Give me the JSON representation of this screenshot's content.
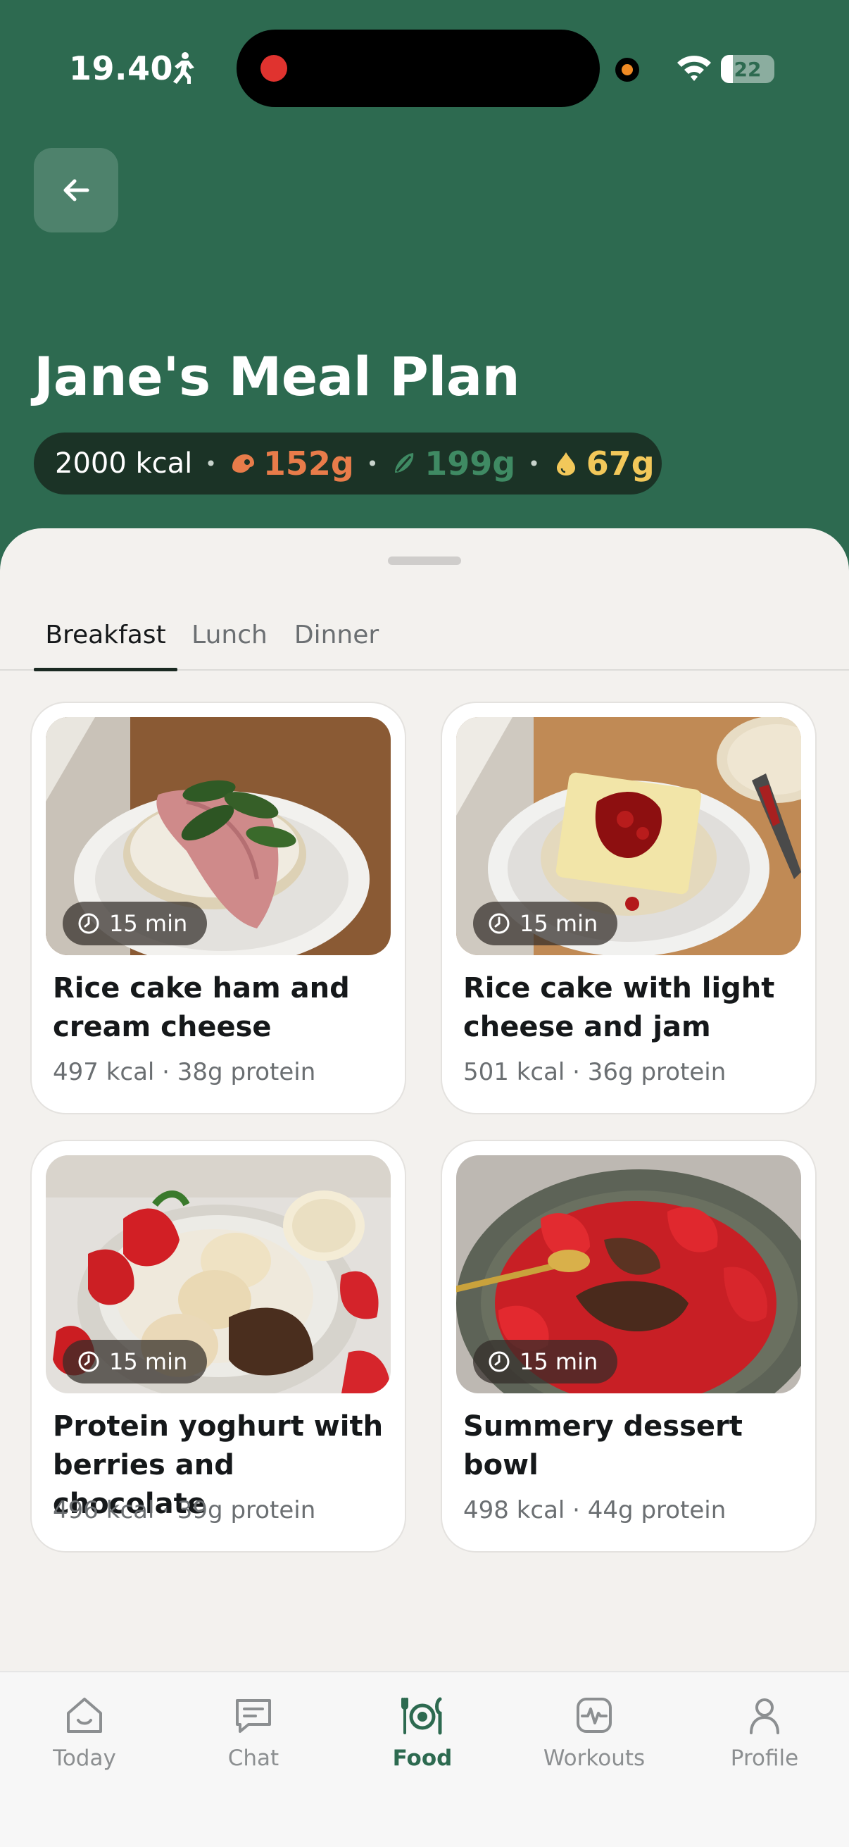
{
  "status_bar": {
    "time": "19.40",
    "battery_level": "22",
    "battery_fraction": 0.22
  },
  "header": {
    "title": "Jane's Meal Plan",
    "back_icon": "arrow-left-icon",
    "calories": "2000 kcal",
    "separator": "•",
    "protein": "152g",
    "carbs": "199g",
    "fat": "67g"
  },
  "colors": {
    "brand_green": "#2d6a50",
    "protein": "#e87c4a",
    "carbs": "#3f8a63",
    "fat": "#f2c85a"
  },
  "tabs": [
    {
      "label": "Breakfast",
      "active": true
    },
    {
      "label": "Lunch",
      "active": false
    },
    {
      "label": "Dinner",
      "active": false
    }
  ],
  "meals": [
    {
      "name": "Rice cake ham and cream cheese",
      "time": "15 min",
      "meta": "497 kcal · 38g protein"
    },
    {
      "name": "Rice cake with light cheese and jam",
      "time": "15 min",
      "meta": "501 kcal · 36g protein"
    },
    {
      "name": "Protein yoghurt with berries and chocolate",
      "time": "15 min",
      "meta": "496 kcal · 39g protein"
    },
    {
      "name": "Summery dessert bowl",
      "time": "15 min",
      "meta": "498 kcal · 44g protein"
    }
  ],
  "nav": [
    {
      "label": "Today",
      "icon": "house-icon"
    },
    {
      "label": "Chat",
      "icon": "chat-icon"
    },
    {
      "label": "Food",
      "icon": "plate-icon",
      "active": true
    },
    {
      "label": "Workouts",
      "icon": "activity-icon"
    },
    {
      "label": "Profile",
      "icon": "person-icon"
    }
  ]
}
